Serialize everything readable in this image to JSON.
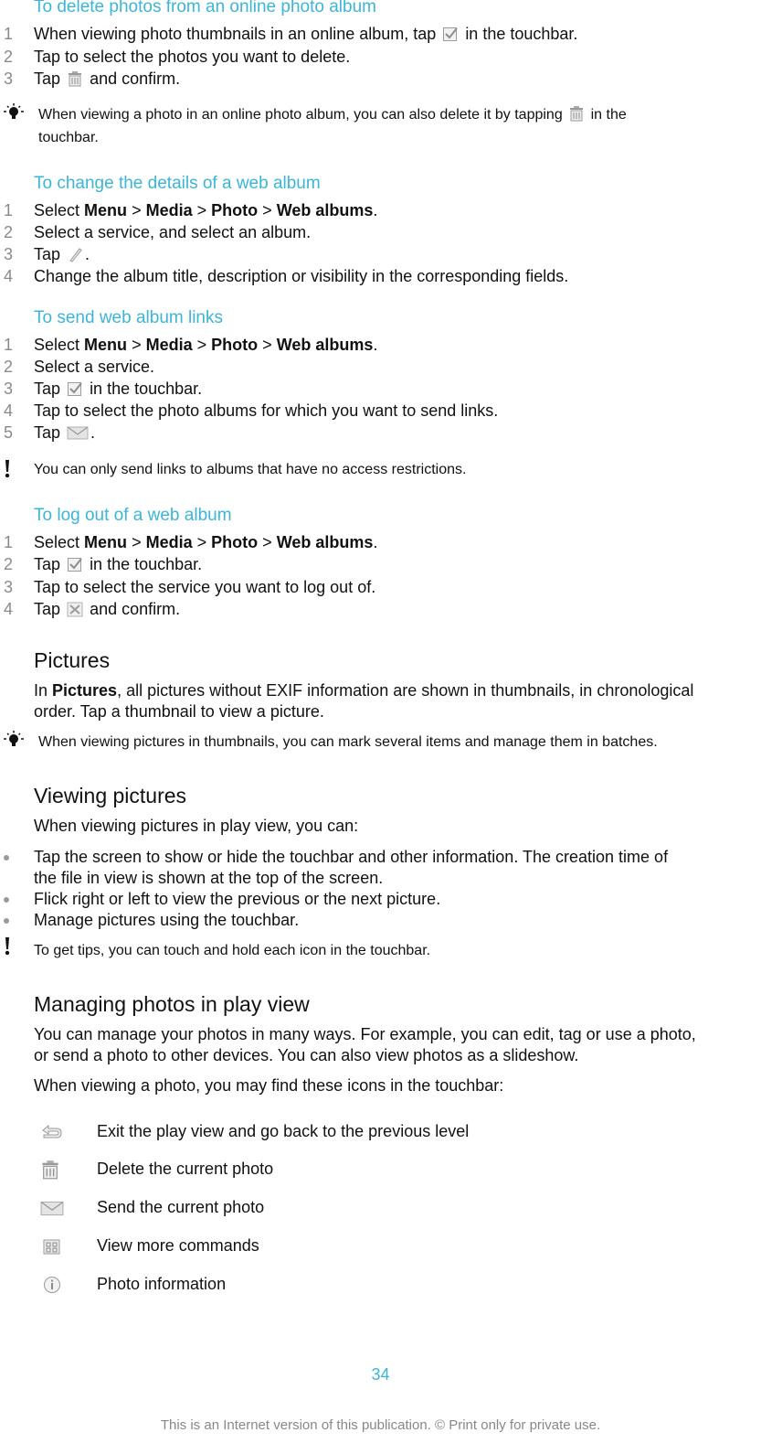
{
  "sections": {
    "delete_online": {
      "heading": "To delete photos from an online photo album",
      "steps": [
        {
          "num": "1",
          "pre": "When viewing photo thumbnails in an online album, tap",
          "icon": "checkbox-icon",
          "post": "in the touchbar."
        },
        {
          "num": "2",
          "text": "Tap to select the photos you want to delete."
        },
        {
          "num": "3",
          "pre": "Tap",
          "icon": "trash-icon",
          "post": "and confirm."
        }
      ],
      "tip": {
        "line1_pre": "When viewing a photo in an online photo album, you can also delete it by tapping",
        "line1_post": "in the",
        "line2": "touchbar."
      }
    },
    "change_details": {
      "heading": "To change the details of a web album",
      "steps": [
        {
          "num": "1",
          "pre": "Select",
          "menu": [
            "Menu",
            "Media",
            "Photo",
            "Web albums"
          ],
          "sep": ">",
          "post": "."
        },
        {
          "num": "2",
          "text": "Select a service, and select an album."
        },
        {
          "num": "3",
          "pre": "Tap",
          "icon": "edit-pencil-icon",
          "post": "."
        },
        {
          "num": "4",
          "text": "Change the album title, description or visibility in the corresponding fields."
        }
      ]
    },
    "send_links": {
      "heading": "To send web album links",
      "steps": [
        {
          "num": "1",
          "pre": "Select",
          "menu": [
            "Menu",
            "Media",
            "Photo",
            "Web albums"
          ],
          "sep": ">",
          "post": "."
        },
        {
          "num": "2",
          "text": "Select a service."
        },
        {
          "num": "3",
          "pre": "Tap",
          "icon": "checkbox-icon",
          "post": "in the touchbar."
        },
        {
          "num": "4",
          "text": "Tap to select the photo albums for which you want to send links."
        },
        {
          "num": "5",
          "pre": "Tap",
          "icon": "envelope-icon",
          "post": "."
        }
      ],
      "warning": "You can only send links to albums that have no access restrictions."
    },
    "log_out": {
      "heading": "To log out of a web album",
      "steps": [
        {
          "num": "1",
          "pre": "Select",
          "menu": [
            "Menu",
            "Media",
            "Photo",
            "Web albums"
          ],
          "sep": ">",
          "post": "."
        },
        {
          "num": "2",
          "pre": "Tap",
          "icon": "checkbox-icon",
          "post": "in the touchbar."
        },
        {
          "num": "3",
          "text": "Tap to select the service you want to log out of."
        },
        {
          "num": "4",
          "pre": "Tap",
          "icon": "logout-cross-icon",
          "post": "and confirm."
        }
      ]
    },
    "pictures": {
      "heading": "Pictures",
      "para_pre": "In",
      "para_bold": "Pictures",
      "para_line1_post": ", all pictures without EXIF information are shown in thumbnails, in chronological",
      "para_line2": "order. Tap a thumbnail to view a picture.",
      "tip": "When viewing pictures in thumbnails, you can mark several items and manage them in batches."
    },
    "viewing_pictures": {
      "heading": "Viewing pictures",
      "intro": "When viewing pictures in play view, you can:",
      "bullets": [
        {
          "line1": "Tap the screen to show or hide the touchbar and other information. The creation time of",
          "line2": "the file in view is shown at the top of the screen."
        },
        {
          "line1": "Flick right or left to view the previous or the next picture."
        },
        {
          "line1": "Manage pictures using the touchbar."
        }
      ],
      "warning": "To get tips, you can touch and hold each icon in the touchbar."
    },
    "managing_photos": {
      "heading": "Managing photos in play view",
      "para_line1": "You can manage your photos in many ways. For example, you can edit, tag or use a photo,",
      "para_line2": "or send a photo to other devices. You can also view photos as a slideshow.",
      "intro": "When viewing a photo, you may find these icons in the touchbar:",
      "icons": [
        {
          "icon": "back-arrow-icon",
          "label": "Exit the play view and go back to the previous level"
        },
        {
          "icon": "trash-icon",
          "label": "Delete the current photo"
        },
        {
          "icon": "envelope-icon",
          "label": "Send the current photo"
        },
        {
          "icon": "more-commands-icon",
          "label": "View more commands"
        },
        {
          "icon": "info-icon",
          "label": "Photo information"
        }
      ]
    }
  },
  "footer": {
    "page_number": "34",
    "notice": "This is an Internet version of this publication. © Print only for private use."
  },
  "colors": {
    "heading_blue": "#3bb6d8",
    "step_number_gray": "#8a8a8a",
    "text": "#111111",
    "footer_gray": "#888888"
  }
}
